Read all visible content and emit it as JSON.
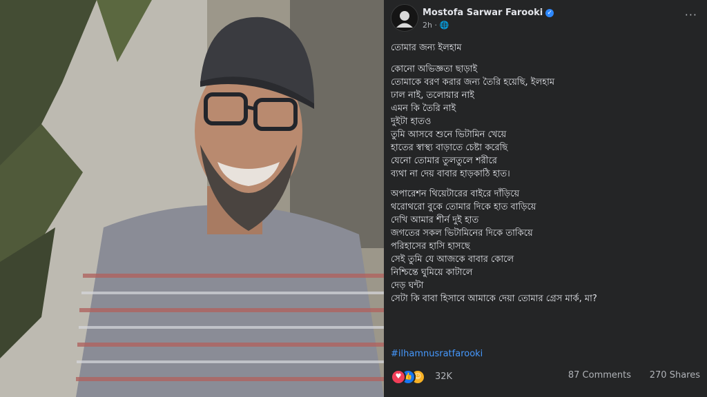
{
  "post": {
    "author": "Mostofa Sarwar Farooki",
    "time": "2h",
    "privacy_icon": "globe-icon",
    "verified_icon": "verified-check-icon",
    "more_icon": "more-options-icon",
    "title": "তোমার জন্য ইলহাম",
    "stanza1": [
      "কোনো অভিজ্ঞতা ছাড়াই",
      "তোমাকে বরণ করার জন্য তৈরি হয়েছি, ইলহাম",
      "ঢাল নাই, তলোয়ার নাই",
      "এমন কি তৈরি নাই",
      "দুইটা হাতও",
      "তুমি আসবে শুনে ভিটামিন খেয়ে",
      "হাতের স্বাস্থ্য বাড়াতে চেষ্টা করেছি",
      "যেনো তোমার তুলতুলে শরীরে",
      "ব্যথা না দেয় বাবার হাড়কাঠি হাত।"
    ],
    "stanza2": [
      "অপারেশন থিয়েটারের বাইরে দাঁড়িয়ে",
      "থরোথরো বুকে তোমার দিকে হাত বাড়িয়ে",
      "দেখি আমার শীর্ন দুই হাত",
      "জগতের সকল ভিটামিনের দিকে তাকিয়ে",
      "পরিহাসের হাসি হাসছে",
      "সেই তুমি যে আজকে বাবার কোলে",
      "নিশ্চিন্তে ঘুমিয়ে কাটালে",
      "দেড় ঘন্টা",
      "সেটা কি বাবা হিসাবে আমাকে দেয়া তোমার গ্রেস মার্ক, মা?"
    ],
    "hashtag": "#ilhamnusratfarooki"
  },
  "engagement": {
    "reaction_icons": [
      "love-icon",
      "like-icon",
      "care-icon"
    ],
    "reaction_count": "32K",
    "comments": "87 Comments",
    "shares": "270 Shares"
  },
  "colors": {
    "panel_bg": "#242526",
    "text": "#e4e6eb",
    "secondary_text": "#b0b3b8",
    "link": "#4599ff",
    "verified": "#2d88ff"
  }
}
